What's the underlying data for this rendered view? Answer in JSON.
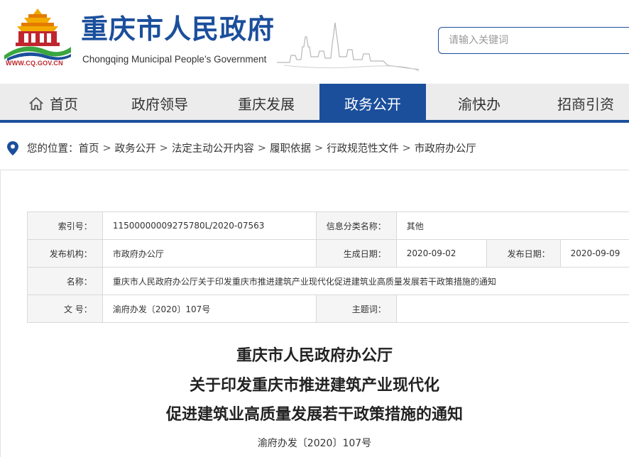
{
  "header": {
    "site_title": "重庆市人民政府",
    "site_subtitle": "Chongqing Municipal People’s Government",
    "site_url": "WWW.CQ.GOV.CN",
    "search_placeholder": "请输入关键词"
  },
  "nav": {
    "items": [
      {
        "label": "首页"
      },
      {
        "label": "政府领导"
      },
      {
        "label": "重庆发展"
      },
      {
        "label": "政务公开"
      },
      {
        "label": "渝快办"
      },
      {
        "label": "招商引资"
      }
    ],
    "active_index": 3
  },
  "breadcrumb": {
    "prefix": "您的位置：",
    "items": [
      "首页",
      "政务公开",
      "法定主动公开内容",
      "履职依据",
      "行政规范性文件",
      "市政府办公厅"
    ],
    "separator": ">"
  },
  "info_table": {
    "index_label": "索引号：",
    "index_value": "11500000009275780L/2020-07563",
    "category_label": "信息分类名称：",
    "category_value": "其他",
    "issuer_label": "发布机构：",
    "issuer_value": "市政府办公厅",
    "created_label": "生成日期：",
    "created_value": "2020-09-02",
    "published_label": "发布日期：",
    "published_value": "2020-09-09",
    "name_label": "名称：",
    "name_value": "重庆市人民政府办公厅关于印发重庆市推进建筑产业现代化促进建筑业高质量发展若干政策措施的通知",
    "docno_label": "文 号：",
    "docno_value": "渝府办发〔2020〕107号",
    "subject_label": "主题词：",
    "subject_value": ""
  },
  "document": {
    "title_line1": "重庆市人民政府办公厅",
    "title_line2": "关于印发重庆市推进建筑产业现代化",
    "title_line3": "促进建筑业高质量发展若干政策措施的通知",
    "doc_number": "渝府办发〔2020〕107号"
  },
  "colors": {
    "brand_blue": "#1b4f9c",
    "emblem_red": "#c0262d",
    "emblem_gold": "#f2a900",
    "nav_bg": "#ececec"
  }
}
